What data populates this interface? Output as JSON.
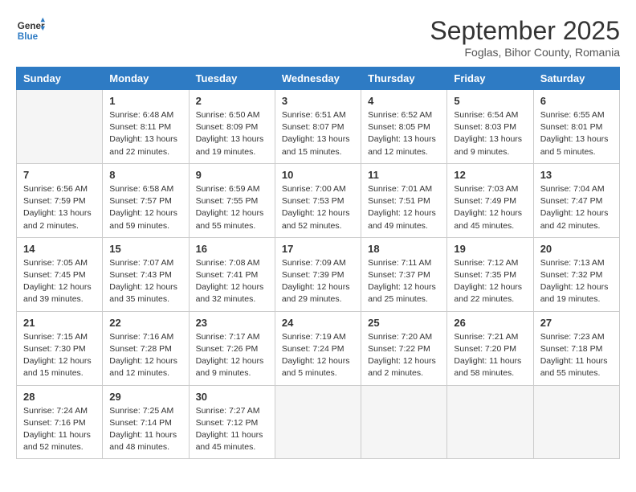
{
  "header": {
    "logo_line1": "General",
    "logo_line2": "Blue",
    "month": "September 2025",
    "location": "Foglas, Bihor County, Romania"
  },
  "days_of_week": [
    "Sunday",
    "Monday",
    "Tuesday",
    "Wednesday",
    "Thursday",
    "Friday",
    "Saturday"
  ],
  "weeks": [
    [
      {
        "day": "",
        "sunrise": "",
        "sunset": "",
        "daylight": ""
      },
      {
        "day": "1",
        "sunrise": "Sunrise: 6:48 AM",
        "sunset": "Sunset: 8:11 PM",
        "daylight": "Daylight: 13 hours and 22 minutes."
      },
      {
        "day": "2",
        "sunrise": "Sunrise: 6:50 AM",
        "sunset": "Sunset: 8:09 PM",
        "daylight": "Daylight: 13 hours and 19 minutes."
      },
      {
        "day": "3",
        "sunrise": "Sunrise: 6:51 AM",
        "sunset": "Sunset: 8:07 PM",
        "daylight": "Daylight: 13 hours and 15 minutes."
      },
      {
        "day": "4",
        "sunrise": "Sunrise: 6:52 AM",
        "sunset": "Sunset: 8:05 PM",
        "daylight": "Daylight: 13 hours and 12 minutes."
      },
      {
        "day": "5",
        "sunrise": "Sunrise: 6:54 AM",
        "sunset": "Sunset: 8:03 PM",
        "daylight": "Daylight: 13 hours and 9 minutes."
      },
      {
        "day": "6",
        "sunrise": "Sunrise: 6:55 AM",
        "sunset": "Sunset: 8:01 PM",
        "daylight": "Daylight: 13 hours and 5 minutes."
      }
    ],
    [
      {
        "day": "7",
        "sunrise": "Sunrise: 6:56 AM",
        "sunset": "Sunset: 7:59 PM",
        "daylight": "Daylight: 13 hours and 2 minutes."
      },
      {
        "day": "8",
        "sunrise": "Sunrise: 6:58 AM",
        "sunset": "Sunset: 7:57 PM",
        "daylight": "Daylight: 12 hours and 59 minutes."
      },
      {
        "day": "9",
        "sunrise": "Sunrise: 6:59 AM",
        "sunset": "Sunset: 7:55 PM",
        "daylight": "Daylight: 12 hours and 55 minutes."
      },
      {
        "day": "10",
        "sunrise": "Sunrise: 7:00 AM",
        "sunset": "Sunset: 7:53 PM",
        "daylight": "Daylight: 12 hours and 52 minutes."
      },
      {
        "day": "11",
        "sunrise": "Sunrise: 7:01 AM",
        "sunset": "Sunset: 7:51 PM",
        "daylight": "Daylight: 12 hours and 49 minutes."
      },
      {
        "day": "12",
        "sunrise": "Sunrise: 7:03 AM",
        "sunset": "Sunset: 7:49 PM",
        "daylight": "Daylight: 12 hours and 45 minutes."
      },
      {
        "day": "13",
        "sunrise": "Sunrise: 7:04 AM",
        "sunset": "Sunset: 7:47 PM",
        "daylight": "Daylight: 12 hours and 42 minutes."
      }
    ],
    [
      {
        "day": "14",
        "sunrise": "Sunrise: 7:05 AM",
        "sunset": "Sunset: 7:45 PM",
        "daylight": "Daylight: 12 hours and 39 minutes."
      },
      {
        "day": "15",
        "sunrise": "Sunrise: 7:07 AM",
        "sunset": "Sunset: 7:43 PM",
        "daylight": "Daylight: 12 hours and 35 minutes."
      },
      {
        "day": "16",
        "sunrise": "Sunrise: 7:08 AM",
        "sunset": "Sunset: 7:41 PM",
        "daylight": "Daylight: 12 hours and 32 minutes."
      },
      {
        "day": "17",
        "sunrise": "Sunrise: 7:09 AM",
        "sunset": "Sunset: 7:39 PM",
        "daylight": "Daylight: 12 hours and 29 minutes."
      },
      {
        "day": "18",
        "sunrise": "Sunrise: 7:11 AM",
        "sunset": "Sunset: 7:37 PM",
        "daylight": "Daylight: 12 hours and 25 minutes."
      },
      {
        "day": "19",
        "sunrise": "Sunrise: 7:12 AM",
        "sunset": "Sunset: 7:35 PM",
        "daylight": "Daylight: 12 hours and 22 minutes."
      },
      {
        "day": "20",
        "sunrise": "Sunrise: 7:13 AM",
        "sunset": "Sunset: 7:32 PM",
        "daylight": "Daylight: 12 hours and 19 minutes."
      }
    ],
    [
      {
        "day": "21",
        "sunrise": "Sunrise: 7:15 AM",
        "sunset": "Sunset: 7:30 PM",
        "daylight": "Daylight: 12 hours and 15 minutes."
      },
      {
        "day": "22",
        "sunrise": "Sunrise: 7:16 AM",
        "sunset": "Sunset: 7:28 PM",
        "daylight": "Daylight: 12 hours and 12 minutes."
      },
      {
        "day": "23",
        "sunrise": "Sunrise: 7:17 AM",
        "sunset": "Sunset: 7:26 PM",
        "daylight": "Daylight: 12 hours and 9 minutes."
      },
      {
        "day": "24",
        "sunrise": "Sunrise: 7:19 AM",
        "sunset": "Sunset: 7:24 PM",
        "daylight": "Daylight: 12 hours and 5 minutes."
      },
      {
        "day": "25",
        "sunrise": "Sunrise: 7:20 AM",
        "sunset": "Sunset: 7:22 PM",
        "daylight": "Daylight: 12 hours and 2 minutes."
      },
      {
        "day": "26",
        "sunrise": "Sunrise: 7:21 AM",
        "sunset": "Sunset: 7:20 PM",
        "daylight": "Daylight: 11 hours and 58 minutes."
      },
      {
        "day": "27",
        "sunrise": "Sunrise: 7:23 AM",
        "sunset": "Sunset: 7:18 PM",
        "daylight": "Daylight: 11 hours and 55 minutes."
      }
    ],
    [
      {
        "day": "28",
        "sunrise": "Sunrise: 7:24 AM",
        "sunset": "Sunset: 7:16 PM",
        "daylight": "Daylight: 11 hours and 52 minutes."
      },
      {
        "day": "29",
        "sunrise": "Sunrise: 7:25 AM",
        "sunset": "Sunset: 7:14 PM",
        "daylight": "Daylight: 11 hours and 48 minutes."
      },
      {
        "day": "30",
        "sunrise": "Sunrise: 7:27 AM",
        "sunset": "Sunset: 7:12 PM",
        "daylight": "Daylight: 11 hours and 45 minutes."
      },
      {
        "day": "",
        "sunrise": "",
        "sunset": "",
        "daylight": ""
      },
      {
        "day": "",
        "sunrise": "",
        "sunset": "",
        "daylight": ""
      },
      {
        "day": "",
        "sunrise": "",
        "sunset": "",
        "daylight": ""
      },
      {
        "day": "",
        "sunrise": "",
        "sunset": "",
        "daylight": ""
      }
    ]
  ]
}
